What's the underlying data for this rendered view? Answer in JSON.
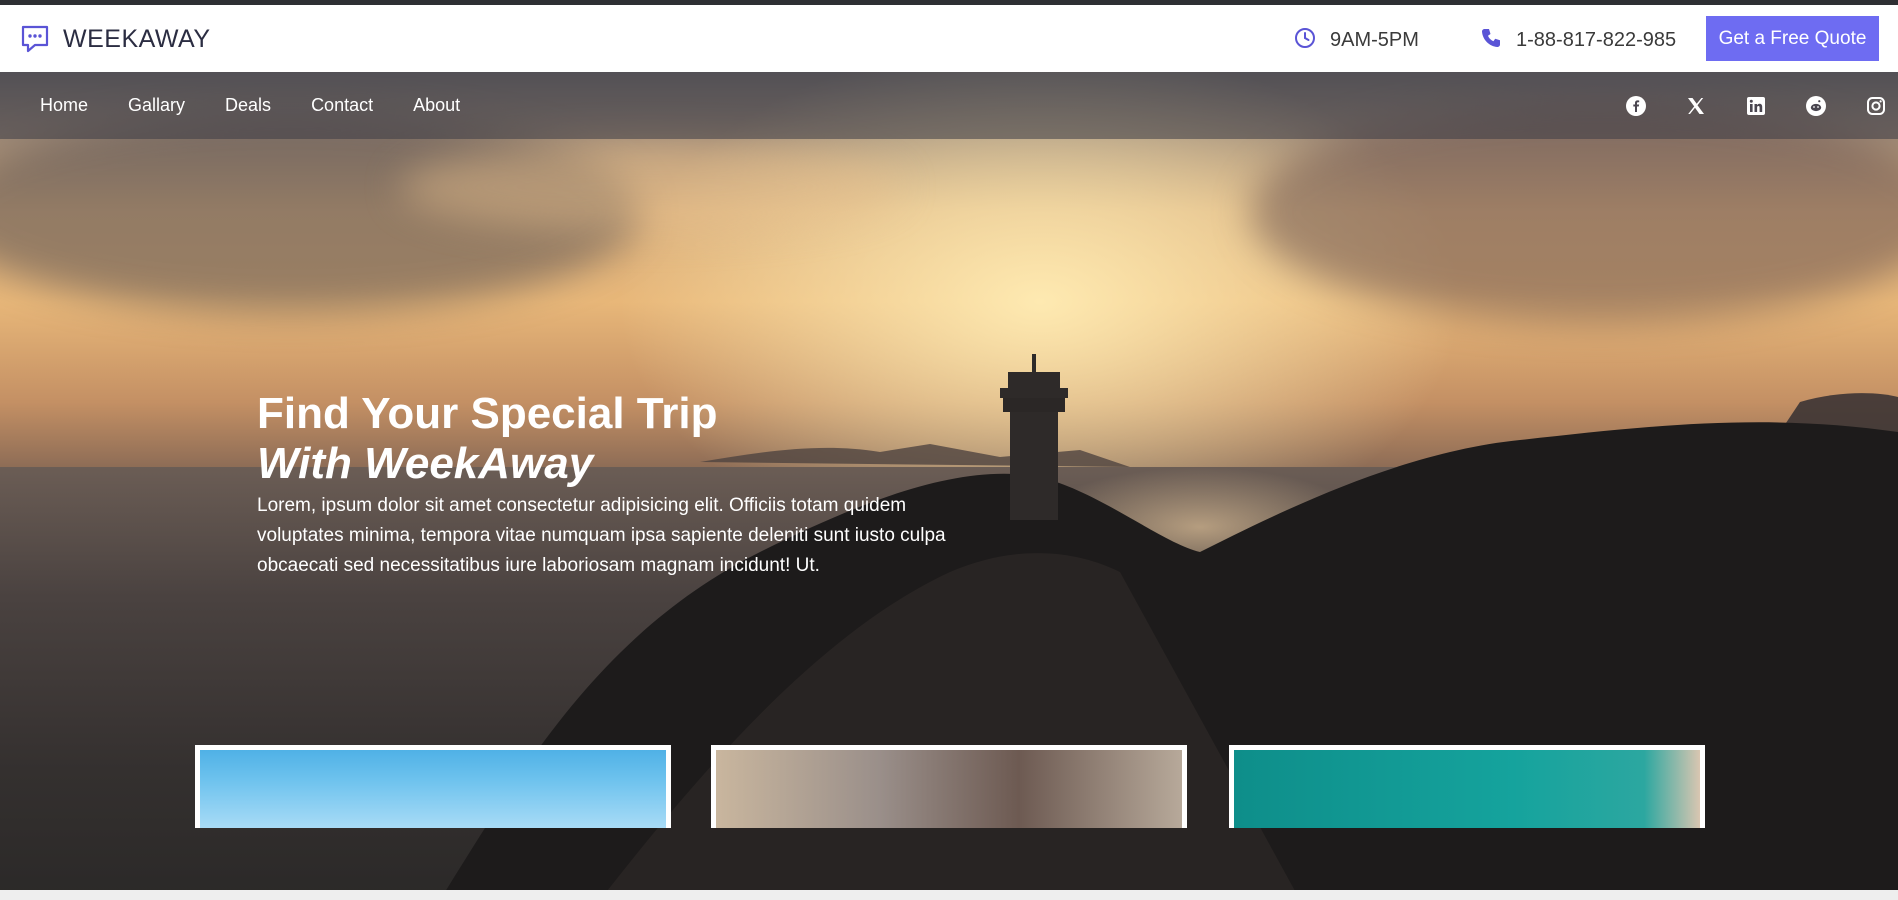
{
  "brand": {
    "name": "WEEKAWAY",
    "logo_icon": "chat-bubble-icon"
  },
  "contact": {
    "hours": "9AM-5PM",
    "hours_icon": "clock-icon",
    "phone": "1-88-817-822-985",
    "phone_icon": "phone-icon",
    "cta_label": "Get a Free Quote"
  },
  "nav": {
    "links": [
      "Home",
      "Gallary",
      "Deals",
      "Contact",
      "About"
    ]
  },
  "socials": [
    "facebook-icon",
    "x-icon",
    "linkedin-icon",
    "reddit-icon",
    "instagram-icon"
  ],
  "hero": {
    "title_line1": "Find Your Special Trip",
    "title_line2": "With WeekAway",
    "description": "Lorem, ipsum dolor sit amet consectetur adipisicing elit. Officiis totam quidem voluptates minima, tempora vitae numquam ipsa sapiente deleniti sunt iusto culpa obcaecati sed necessitatibus iure laboriosam magnam incidunt! Ut."
  },
  "colors": {
    "accent": "#6e6cf2",
    "brand_text": "#2b2d42",
    "icon_accent": "#5a54d6"
  }
}
